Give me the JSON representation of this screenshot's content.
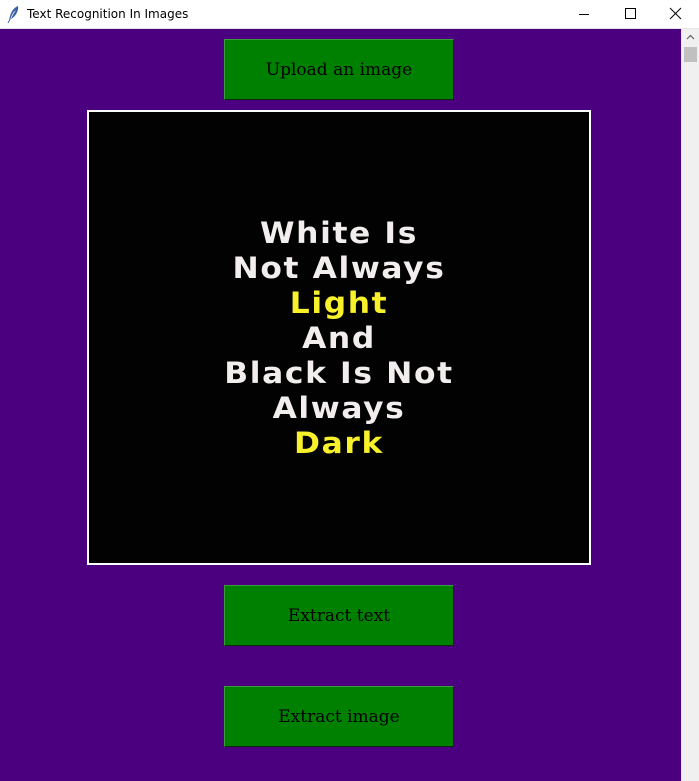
{
  "window": {
    "title": "Text Recognition In Images"
  },
  "buttons": {
    "upload_label": "Upload an image",
    "extract_text_label": "Extract text",
    "extract_image_label": "Extract image"
  },
  "image": {
    "lines": [
      {
        "text": "White Is",
        "color": "#f2eeee"
      },
      {
        "text": "Not Always",
        "color": "#f2eeee"
      },
      {
        "text": "Light",
        "color": "#f7f02a"
      },
      {
        "text": "And",
        "color": "#f2eeee"
      },
      {
        "text": "Black Is Not",
        "color": "#f2eeee"
      },
      {
        "text": "Always",
        "color": "#f2eeee"
      },
      {
        "text": "Dark",
        "color": "#f7f02a"
      }
    ]
  },
  "colors": {
    "background": "#4b0080",
    "button": "#008000",
    "image_background": "#020202"
  }
}
